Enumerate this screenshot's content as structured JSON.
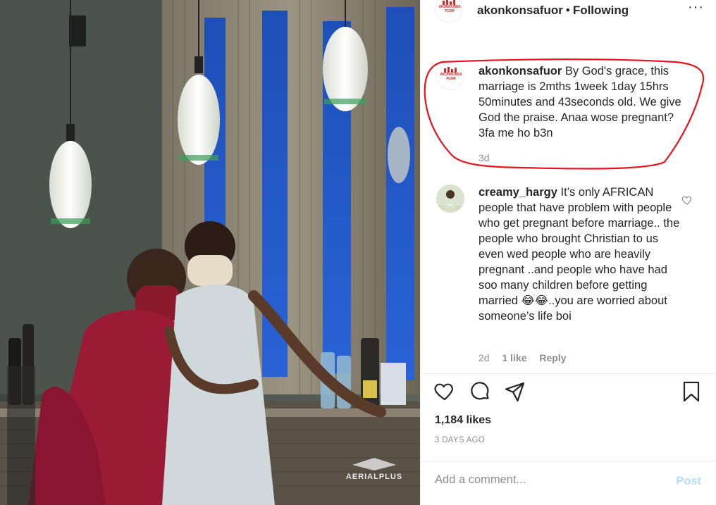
{
  "header": {
    "username": "akonkonsafuor",
    "separator": "•",
    "follow_status": "Following",
    "more": "···"
  },
  "brand_logo": {
    "text": "AKONKONSA FUOR"
  },
  "caption": {
    "username": "akonkonsafuor",
    "text": "By God's grace, this marriage is 2mths 1week 1day 15hrs 50minutes and 43seconds old. We give God the praise. Anaa wose pregnant? 3fa me ho b3n",
    "time": "3d"
  },
  "comments": [
    {
      "username": "creamy_hargy",
      "text": "It’s only AFRICAN people that have problem with people who get pregnant before marriage.. the people who brought Christian to us even wed people who are heavily pregnant ..and people who have had soo many children before getting married 😂😂..you are worried about someone’s life boi",
      "time": "2d",
      "likes": "1 like",
      "reply": "Reply"
    }
  ],
  "icons": {
    "like": "heart-icon",
    "comment": "comment-icon",
    "share": "paper-plane-icon",
    "save": "bookmark-icon",
    "comment_like": "heart-icon"
  },
  "likes_count": "1,184 likes",
  "post_date": "3 DAYS AGO",
  "add_comment": {
    "placeholder": "Add a comment...",
    "post_label": "Post"
  },
  "photo": {
    "watermark": "AERIALPLUS"
  },
  "colors": {
    "highlight": "#e8121c",
    "link_disabled": "#b2dffc",
    "muted": "#8e8e8e",
    "text": "#262626"
  }
}
